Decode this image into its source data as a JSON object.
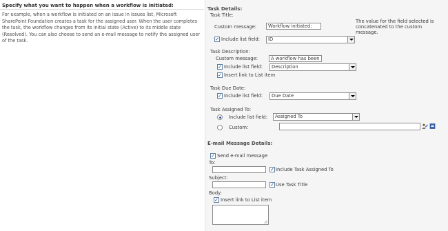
{
  "left": {
    "title": "Specify what you want to happen when a workflow is initiated:",
    "description": "For example, when a workflow is initiated on an issue in Issues list, Microsoft SharePoint Foundation creates a task for the assigned user. When the user completes the task, the workflow changes from its initial state (Active) to its middle state (Resolved). You can also choose to send an e-mail message to notify the assigned user of the task."
  },
  "task_details": {
    "heading": "Task Details:",
    "task_title": {
      "label": "Task Title:",
      "custom_message_label": "Custom message:",
      "custom_message_value": "Workflow initiated:",
      "include_label": "Include list field:",
      "include_checked": true,
      "include_value": "ID",
      "note": "The value for the field selected is concatenated to the custom message."
    },
    "task_description": {
      "label": "Task Description:",
      "custom_message_label": "Custom message:",
      "custom_message_value": "A workflow has been",
      "include_label": "Include list field:",
      "include_checked": true,
      "include_value": "Description",
      "insert_link_label": "Insert link to List item",
      "insert_link_checked": true
    },
    "task_due_date": {
      "label": "Task Due Date:",
      "include_label": "Include list field:",
      "include_checked": true,
      "include_value": "Due Date"
    },
    "task_assigned_to": {
      "label": "Task Assigned To:",
      "include_label": "Include list field:",
      "include_value": "Assigned To",
      "include_selected": true,
      "custom_label": "Custom:",
      "custom_value": ""
    }
  },
  "email": {
    "heading": "E-mail Message Details:",
    "send_label": "Send e-mail message",
    "send_checked": true,
    "to_label": "To:",
    "to_value": "",
    "include_assigned_label": "Include Task Assigned To",
    "include_assigned_checked": true,
    "subject_label": "Subject:",
    "subject_value": "",
    "use_title_label": "Use Task Title",
    "use_title_checked": true,
    "body_label": "Body:",
    "insert_link_label": "Insert link to List item",
    "insert_link_checked": true,
    "body_value": ""
  },
  "icons": [
    "people-picker-icon",
    "address-book-icon",
    "dropdown-arrow-icon",
    "checkmark-icon",
    "radio-icon"
  ],
  "colors": {
    "panel_bg": "#f5f5f5",
    "check_color": "#1d3a78",
    "radio_selected": "#2a5ab5"
  }
}
